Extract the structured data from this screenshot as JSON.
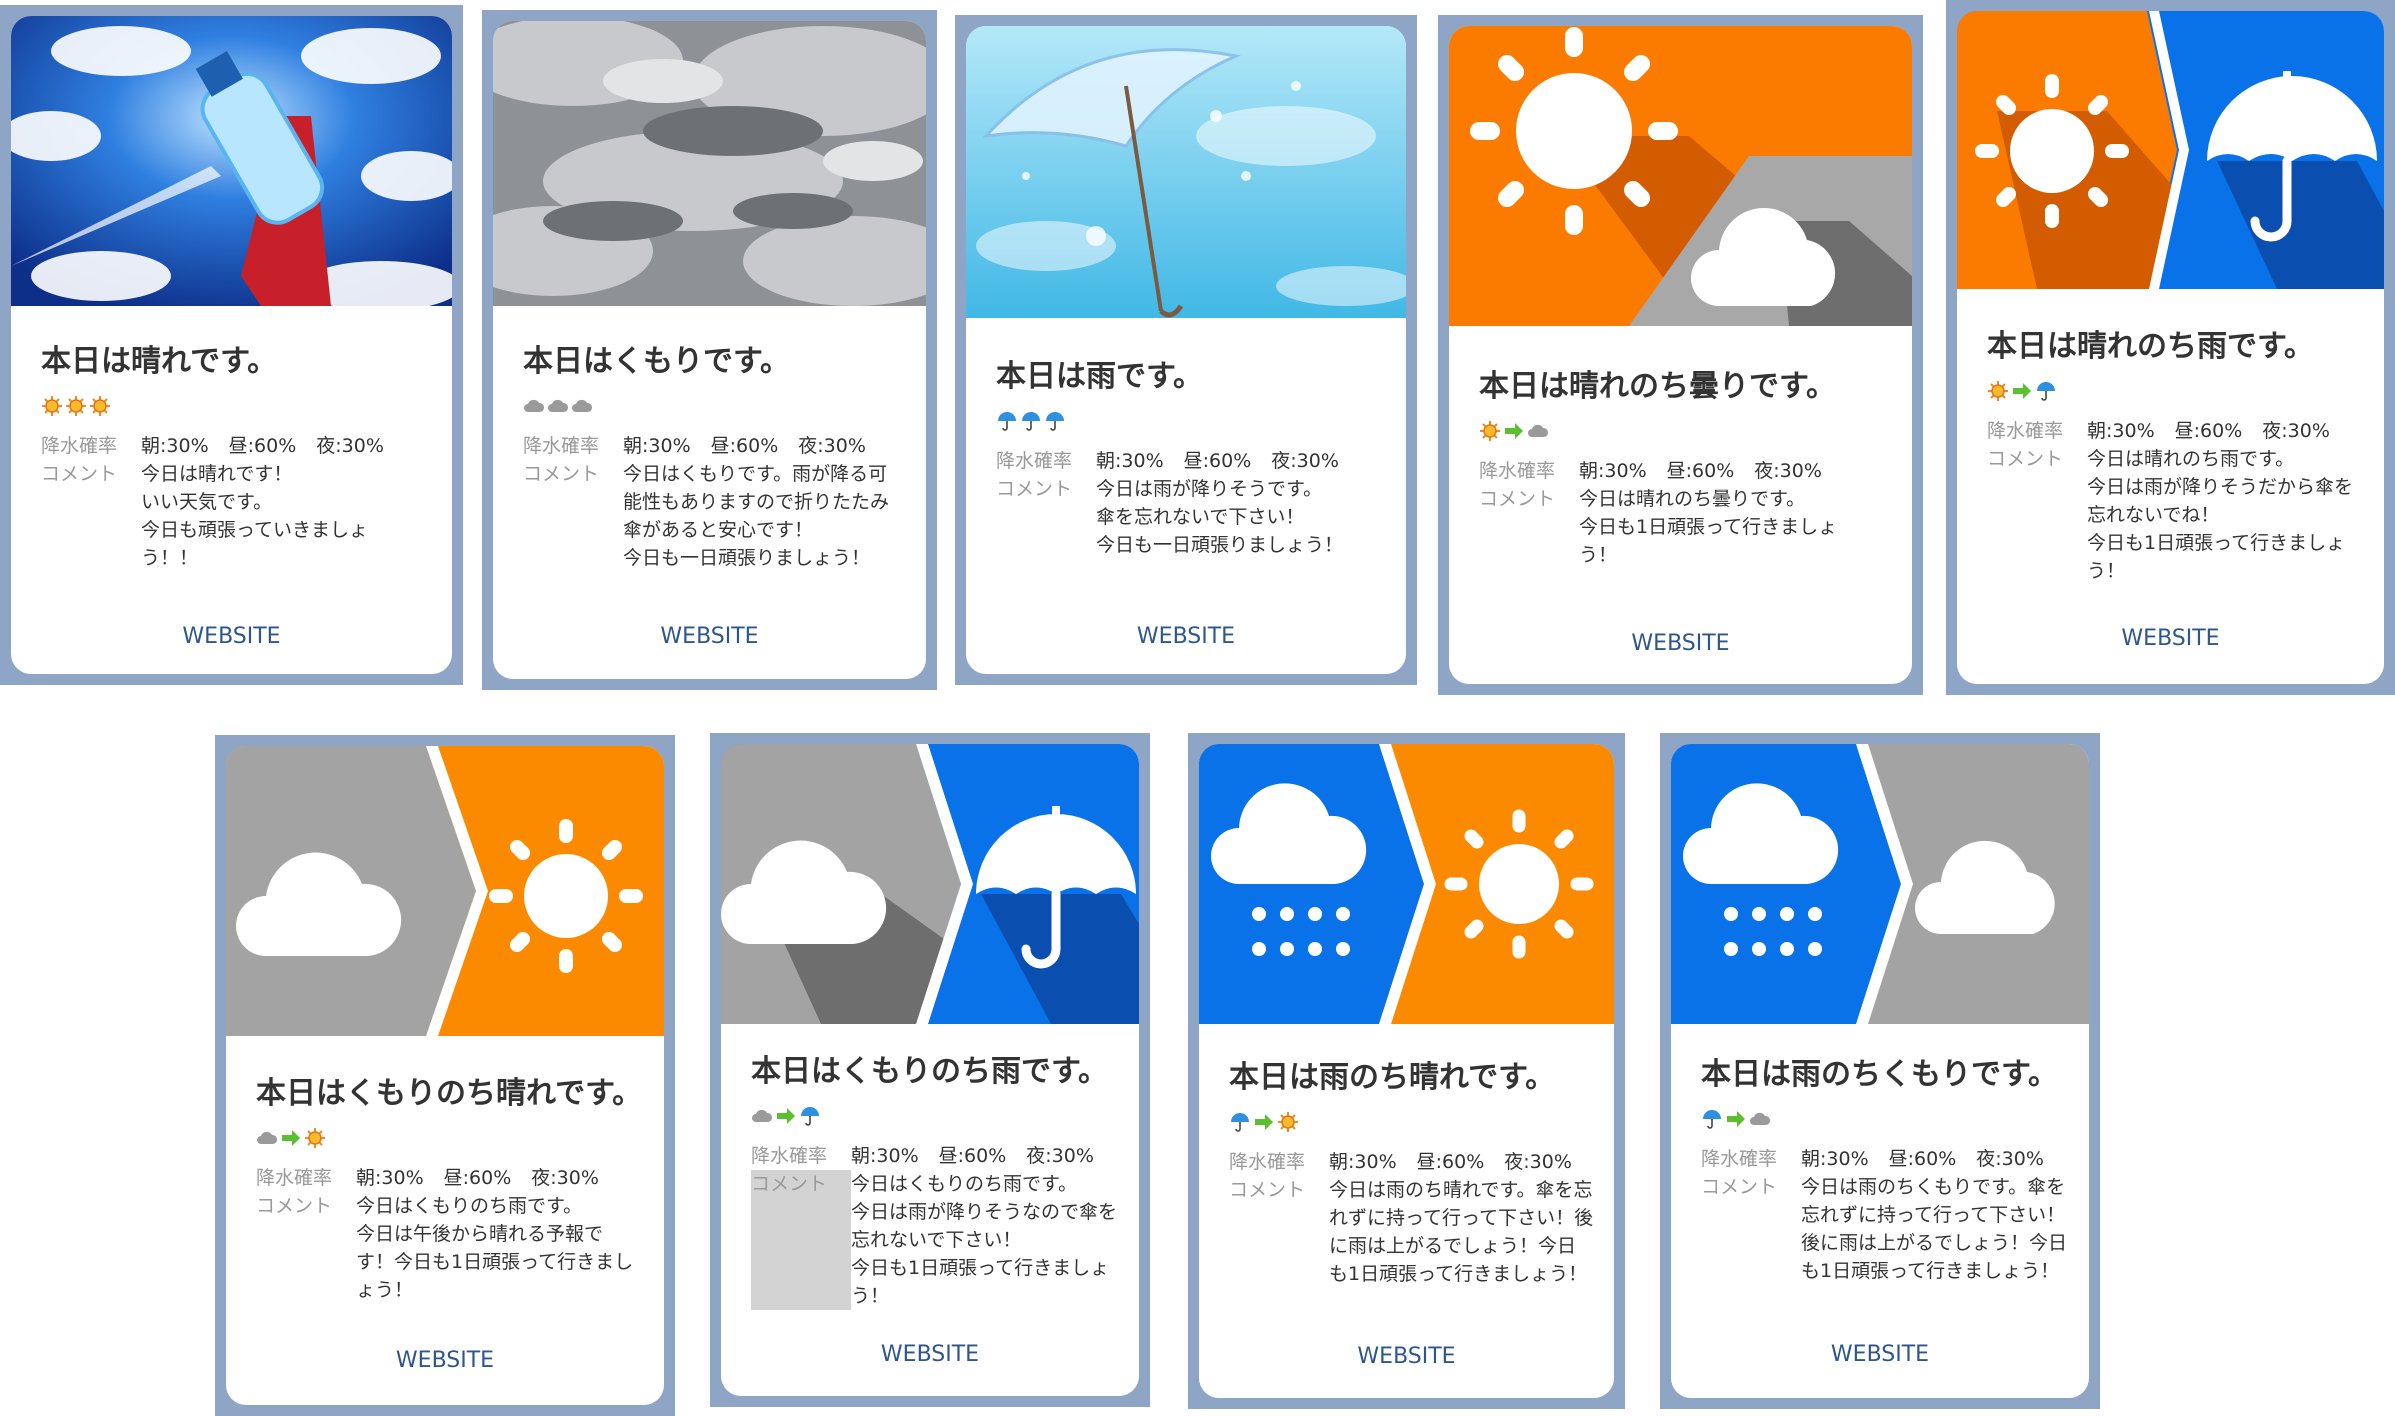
{
  "labels": {
    "precip": "降水確率",
    "comment": "コメント",
    "website": "WEBSITE"
  },
  "cards": [
    {
      "title": "本日は晴れです。",
      "icons": [
        "sun-icon",
        "sun-icon",
        "sun-icon"
      ],
      "morning": "朝:30%",
      "noon": "昼:60%",
      "night": "夜:30%",
      "comment": "今日は晴れです！\nいい天気です。\n今日も頑張っていきましょう！！"
    },
    {
      "title": "本日はくもりです。",
      "icons": [
        "cloud-icon",
        "cloud-icon",
        "cloud-icon"
      ],
      "morning": "朝:30%",
      "noon": "昼:60%",
      "night": "夜:30%",
      "comment": "今日はくもりです。雨が降る可能性もありますので折りたたみ傘があると安心です！\n今日も一日頑張りましょう！"
    },
    {
      "title": "本日は雨です。",
      "icons": [
        "umbrella-icon",
        "umbrella-icon",
        "umbrella-icon"
      ],
      "morning": "朝:30%",
      "noon": "昼:60%",
      "night": "夜:30%",
      "comment": "今日は雨が降りそうです。\n傘を忘れないで下さい！\n今日も一日頑張りましょう！"
    },
    {
      "title": "本日は晴れのち曇りです。",
      "icons": [
        "sun-icon",
        "arrow-right-icon",
        "cloud-icon"
      ],
      "morning": "朝:30%",
      "noon": "昼:60%",
      "night": "夜:30%",
      "comment": "今日は晴れのち曇りです。\n今日も1日頑張って行きましょう！"
    },
    {
      "title": "本日は晴れのち雨です。",
      "icons": [
        "sun-icon",
        "arrow-right-icon",
        "umbrella-icon"
      ],
      "morning": "朝:30%",
      "noon": "昼:60%",
      "night": "夜:30%",
      "comment": "今日は晴れのち雨です。\n今日は雨が降りそうだから傘を忘れないでね！\n今日も1日頑張って行きましょう！"
    },
    {
      "title": "本日はくもりのち晴れです。",
      "icons": [
        "cloud-icon",
        "arrow-right-icon",
        "sun-icon"
      ],
      "morning": "朝:30%",
      "noon": "昼:60%",
      "night": "夜:30%",
      "comment": "今日はくもりのち雨です。\n今日は午後から晴れる予報です！今日も1日頑張って行きましょう！"
    },
    {
      "title": "本日はくもりのち雨です。",
      "icons": [
        "cloud-icon",
        "arrow-right-icon",
        "umbrella-icon"
      ],
      "morning": "朝:30%",
      "noon": "昼:60%",
      "night": "夜:30%",
      "comment": "今日はくもりのち雨です。\n今日は雨が降りそうなので傘を忘れないで下さい！\n今日も1日頑張って行きましょう！"
    },
    {
      "title": "本日は雨のち晴れです。",
      "icons": [
        "umbrella-icon",
        "arrow-right-icon",
        "sun-icon"
      ],
      "morning": "朝:30%",
      "noon": "昼:60%",
      "night": "夜:30%",
      "comment": "今日は雨のち晴れです。傘を忘れずに持って行って下さい！後に雨は上がるでしょう！今日も1日頑張って行きましょう！"
    },
    {
      "title": "本日は雨のちくもりです。",
      "icons": [
        "umbrella-icon",
        "arrow-right-icon",
        "cloud-icon"
      ],
      "morning": "朝:30%",
      "noon": "昼:60%",
      "night": "夜:30%",
      "comment": "今日は雨のちくもりです。傘を忘れずに持って行って下さい！後に雨は上がるでしょう！今日も1日頑張って行きましょう！"
    }
  ]
}
